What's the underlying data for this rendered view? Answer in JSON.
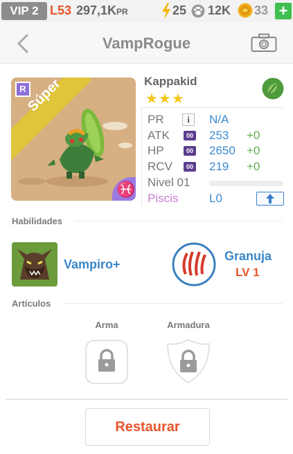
{
  "status_bar": {
    "vip": "VIP 2",
    "level": "L53",
    "power": "297,1K",
    "power_unit": "PR",
    "energy": "25",
    "paws": "12K",
    "coins": "33",
    "plus": "+"
  },
  "nav": {
    "title": "VampRogue"
  },
  "pet": {
    "rarity_badge": "R",
    "rarity_banner": "Súper",
    "sign_symbol": "♓",
    "name": "Kappakid",
    "stars": "★★★",
    "stats": [
      {
        "label": "PR",
        "value": "N/A",
        "bonus": ""
      },
      {
        "label": "ATK",
        "icon": "00",
        "value": "253",
        "bonus": "+0"
      },
      {
        "label": "HP",
        "icon": "00",
        "value": "2650",
        "bonus": "+0"
      },
      {
        "label": "RCV",
        "icon": "00",
        "value": "219",
        "bonus": "+0"
      }
    ],
    "info_icon": "i",
    "level_label": "Nivel 01",
    "level_progress": 0,
    "sign_label": "Piscis",
    "sign_level": "L0",
    "element_color": "#4e9a3c"
  },
  "abilities": {
    "section": "Habilidades",
    "skill_name": "Vampiro+",
    "ability_name": "Granuja",
    "ability_level": "LV 1"
  },
  "items": {
    "section": "Artículos",
    "weapon_label": "Arma",
    "armor_label": "Armadura"
  },
  "restore_label": "Restaurar"
}
